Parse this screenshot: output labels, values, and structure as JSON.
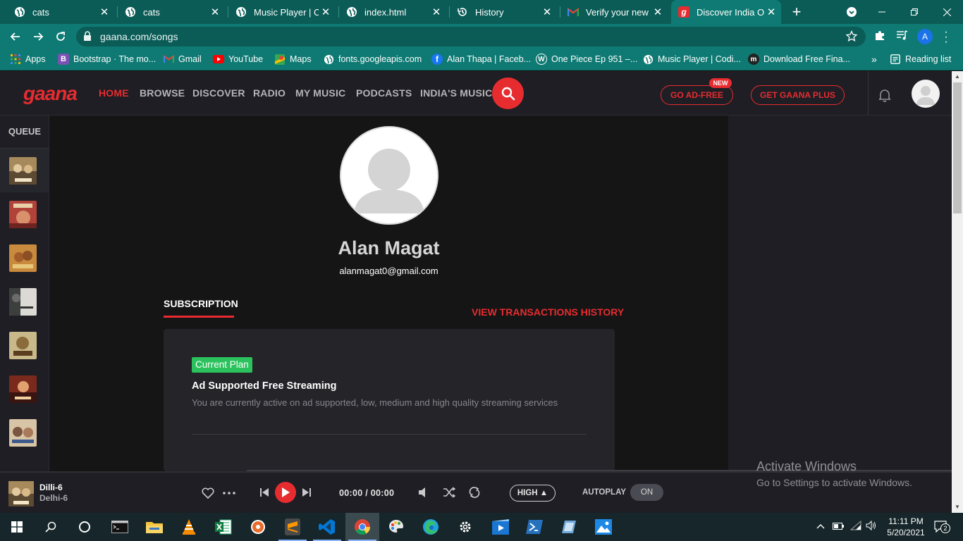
{
  "browser": {
    "tabs": [
      {
        "title": "cats",
        "icon": "globe-icon",
        "active": false
      },
      {
        "title": "cats",
        "icon": "globe-icon",
        "active": false
      },
      {
        "title": "Music Player | Co",
        "icon": "globe-icon",
        "active": false
      },
      {
        "title": "index.html",
        "icon": "globe-icon",
        "active": false
      },
      {
        "title": "History",
        "icon": "history-icon",
        "active": false
      },
      {
        "title": "Verify your new A",
        "icon": "gmail-icon",
        "active": false
      },
      {
        "title": "Discover India On",
        "icon": "gaana-icon",
        "active": true
      }
    ],
    "close_glyph": "✕",
    "new_tab_glyph": "+",
    "url": "gaana.com/songs",
    "profile_initial": "A",
    "bookmarks": [
      {
        "label": "Apps",
        "icon": "apps-grid-icon"
      },
      {
        "label": "Bootstrap · The mo...",
        "icon": "bootstrap-icon"
      },
      {
        "label": "Gmail",
        "icon": "gmail-icon"
      },
      {
        "label": "YouTube",
        "icon": "youtube-icon"
      },
      {
        "label": "Maps",
        "icon": "maps-icon"
      },
      {
        "label": "fonts.googleapis.com",
        "icon": "globe-icon"
      },
      {
        "label": "Alan Thapa | Faceb...",
        "icon": "facebook-icon"
      },
      {
        "label": "One Piece Ep 951 –...",
        "icon": "wordpress-icon"
      },
      {
        "label": "Music Player | Codi...",
        "icon": "globe-icon"
      },
      {
        "label": "Download Free Fina...",
        "icon": "m-icon"
      }
    ],
    "bookmarks_overflow": "»",
    "reading_list": "Reading list"
  },
  "gaana": {
    "logo": "gaana",
    "nav": [
      "HOME",
      "BROWSE",
      "DISCOVER",
      "RADIO",
      "MY MUSIC",
      "PODCASTS",
      "INDIA'S MUSIC"
    ],
    "active_nav": "HOME",
    "go_ad_free": "GO AD-FREE",
    "new_badge": "NEW",
    "get_plus": "GET GAANA PLUS",
    "accent": "#e72c30"
  },
  "queue": {
    "title": "QUEUE",
    "count": 7
  },
  "profile": {
    "name": "Alan Magat",
    "email": "alanmagat0@gmail.com",
    "subscription_tab": "SUBSCRIPTION",
    "view_transactions": "VIEW TRANSACTIONS HISTORY",
    "plan_badge": "Current Plan",
    "plan_name": "Ad Supported Free Streaming",
    "plan_desc": "You are currently active on ad supported, low, medium and high quality streaming services"
  },
  "player": {
    "song": "Dilli-6",
    "album": "Delhi-6",
    "time": "00:00 / 00:00",
    "quality": "HIGH ▲",
    "autoplay_label": "AUTOPLAY",
    "autoplay_state": "ON"
  },
  "watermark": {
    "line1": "Activate Windows",
    "line2": "Go to Settings to activate Windows."
  },
  "taskbar": {
    "time": "11:11 PM",
    "date": "5/20/2021",
    "notifications": "2"
  }
}
